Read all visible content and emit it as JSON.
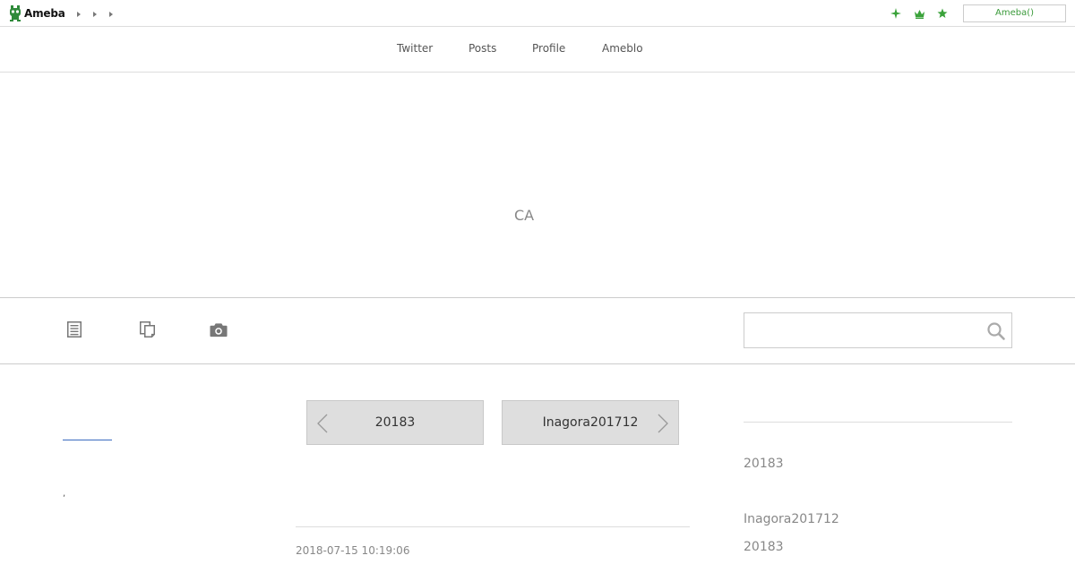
{
  "topbar": {
    "logo_text": "Ameba",
    "breadcrumb_count": 3,
    "icons": [
      "sparkle-icon",
      "crown-icon",
      "star-icon"
    ],
    "account_button": "Ameba()"
  },
  "nav": {
    "items": [
      "Twitter",
      "Posts",
      "Profile",
      "Ameblo"
    ]
  },
  "header": {
    "blog_title": "CA"
  },
  "toolbar": {
    "icons": [
      "article-list-icon",
      "copy-pages-icon",
      "camera-icon"
    ],
    "search": {
      "placeholder": "",
      "value": ""
    }
  },
  "pager": {
    "prev_label": "20183",
    "next_label": "Inagora201712"
  },
  "post": {
    "date": "2018-07-15 10:19:06"
  },
  "left": {
    "dot": ","
  },
  "sidebar": {
    "links": [
      "20183",
      "Inagora201712",
      "20183"
    ]
  },
  "colors": {
    "accent_green": "#3aa23a",
    "tab_underline": "#3a6bbf",
    "pager_bg": "#dedede"
  }
}
